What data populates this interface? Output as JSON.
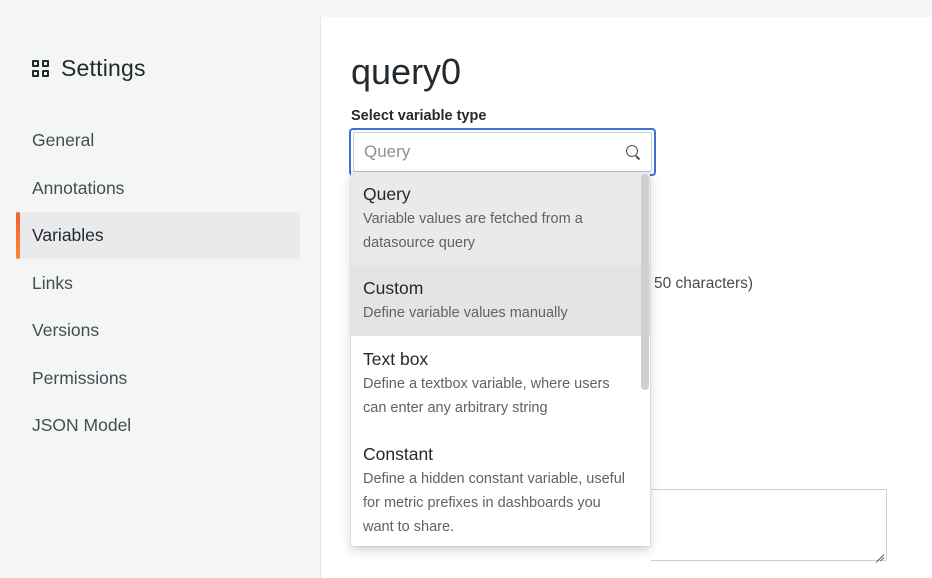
{
  "sidebar": {
    "title": "Settings",
    "items": [
      {
        "label": "General"
      },
      {
        "label": "Annotations"
      },
      {
        "label": "Variables"
      },
      {
        "label": "Links"
      },
      {
        "label": "Versions"
      },
      {
        "label": "Permissions"
      },
      {
        "label": "JSON Model"
      }
    ],
    "active_index": 2
  },
  "main": {
    "title": "query0",
    "type_label": "Select variable type",
    "search": {
      "value": "",
      "placeholder": "Query"
    },
    "hint_fragment": "50 characters)"
  },
  "dropdown": {
    "options": [
      {
        "label": "Query",
        "description": "Variable values are fetched from a datasource query"
      },
      {
        "label": "Custom",
        "description": "Define variable values manually"
      },
      {
        "label": "Text box",
        "description": "Define a textbox variable, where users can enter any arbitrary string"
      },
      {
        "label": "Constant",
        "description": "Define a hidden constant variable, useful for metric prefixes in dashboards you want to share."
      }
    ]
  },
  "colors": {
    "accent": "#3d71d9",
    "active_bar": "#f15f34"
  }
}
